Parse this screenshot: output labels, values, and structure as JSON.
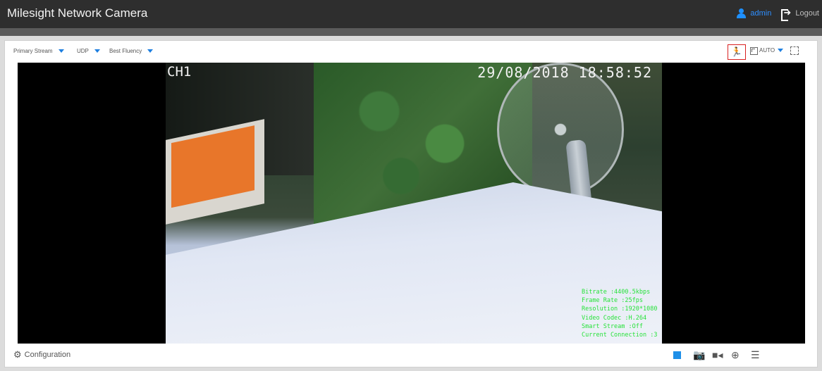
{
  "header": {
    "title": "Milesight Network Camera",
    "user": "admin",
    "logout": "Logout",
    "accent_color": "#2e8fff"
  },
  "toolbar": {
    "stream": "Primary Stream",
    "protocol": "UDP",
    "fluency": "Best Fluency",
    "ratio": "AUTO",
    "motion_icon": "running-man-icon",
    "ratio_icon": "aspect-ratio-icon",
    "fullscreen_icon": "fullscreen-icon"
  },
  "video": {
    "channel": "CH1",
    "timestamp": "29/08/2018 18:58:52",
    "stats": [
      "Bitrate :4400.5kbps",
      "Frame Rate :25fps",
      "Resolution :1920*1080",
      "Video Codec :H.264",
      "Smart Stream :Off",
      "Current Connection :3"
    ],
    "osd_text_color": "#27e23a"
  },
  "footer": {
    "configuration": "Configuration",
    "controls": [
      "stop-icon",
      "snapshot-icon",
      "record-icon",
      "zoom-in-icon",
      "image-settings-icon"
    ]
  }
}
